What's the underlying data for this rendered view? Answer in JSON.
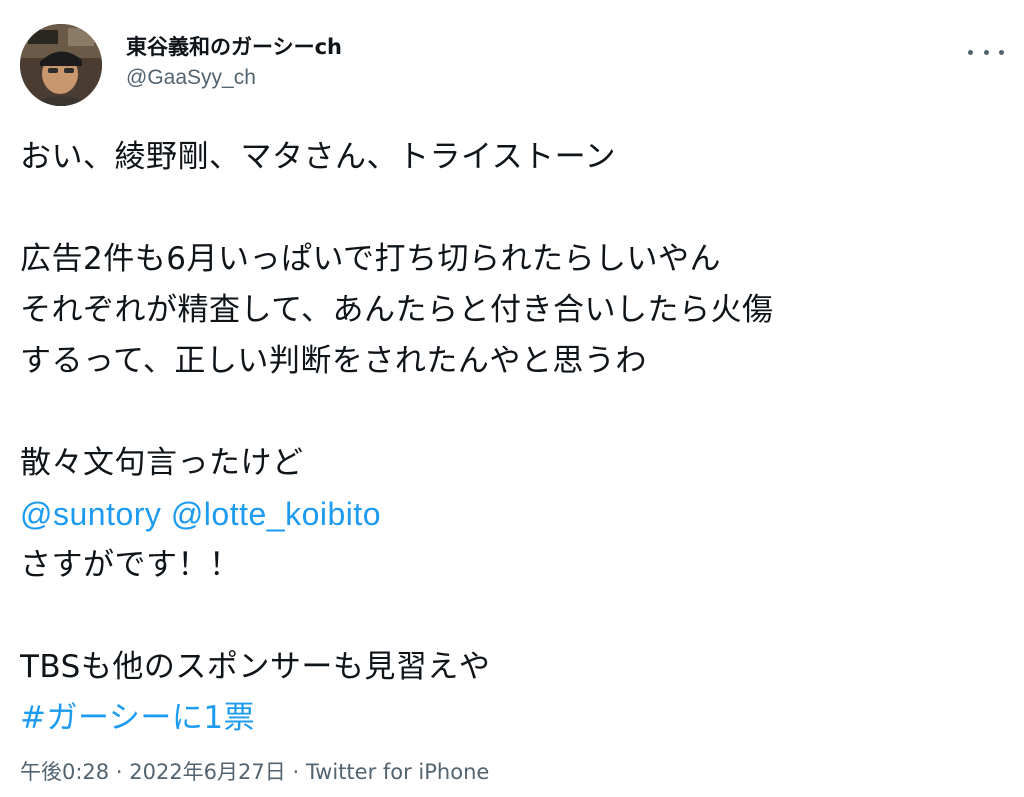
{
  "author": {
    "display_name": "東谷義和のガーシーch",
    "handle": "@GaaSyy_ch"
  },
  "more_icon": "more-horizontal-icon",
  "body": {
    "line1": "おい、綾野剛、マタさん、トライストーン",
    "line2": "広告2件も6月いっぱいで打ち切られたらしいやん",
    "line3": "それぞれが精査して、あんたらと付き合いしたら火傷",
    "line4": "するって、正しい判断をされたんやと思うわ",
    "line5": "散々文句言ったけど",
    "mention1": "@suntory",
    "mention2": "@lotte_koibito",
    "line7": "さすがです！！",
    "line8": "TBSも他のスポンサーも見習えや",
    "hashtag": "#ガーシーに1票"
  },
  "meta": {
    "time": "午後0:28",
    "date": "2022年6月27日",
    "source": "Twitter for iPhone",
    "separator": "·"
  },
  "colors": {
    "link": "#1d9bf0",
    "secondary_text": "#536471",
    "primary_text": "#0f1419"
  }
}
